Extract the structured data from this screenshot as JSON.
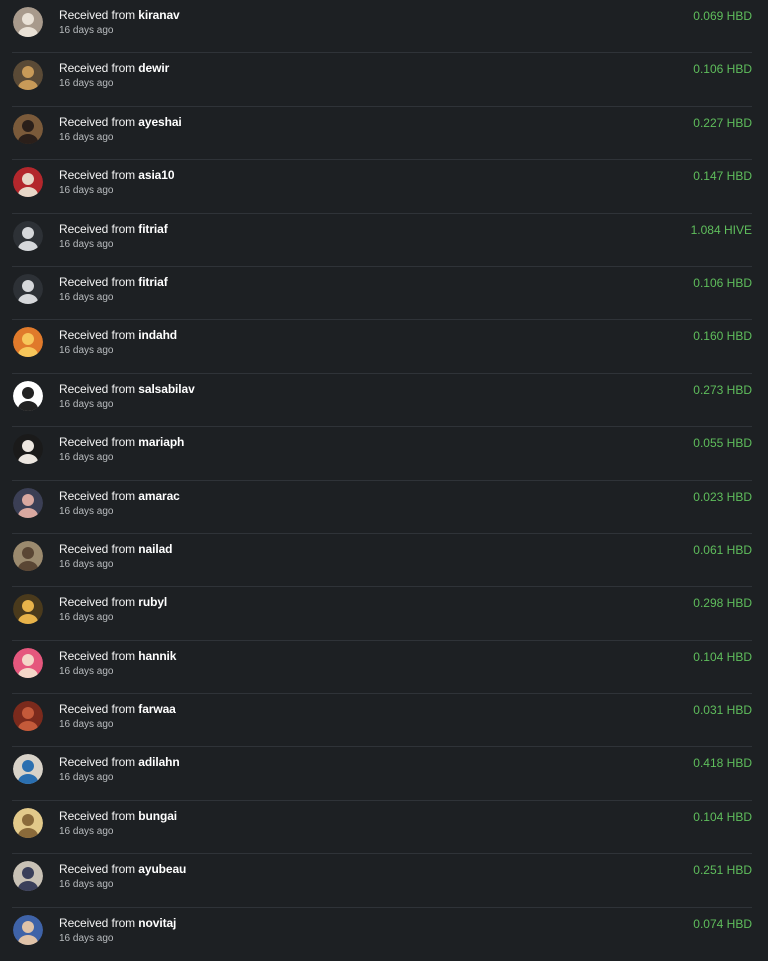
{
  "transactions": [
    {
      "prefix": "Received from",
      "user": "kiranav",
      "time": "16 days ago",
      "amount": "0.069 HBD",
      "avatar_color": "#a89a8c",
      "avatar_accent": "#e9e1d6",
      "avatar_icon": "user-avatar-icon"
    },
    {
      "prefix": "Received from",
      "user": "dewir",
      "time": "16 days ago",
      "amount": "0.106 HBD",
      "avatar_color": "#5a4a36",
      "avatar_accent": "#c89a58",
      "avatar_icon": "user-avatar-icon"
    },
    {
      "prefix": "Received from",
      "user": "ayeshai",
      "time": "16 days ago",
      "amount": "0.227 HBD",
      "avatar_color": "#7a5a3a",
      "avatar_accent": "#2a1f1a",
      "avatar_icon": "user-avatar-icon"
    },
    {
      "prefix": "Received from",
      "user": "asia10",
      "time": "16 days ago",
      "amount": "0.147 HBD",
      "avatar_color": "#b3272c",
      "avatar_accent": "#e8d7c8",
      "avatar_icon": "user-avatar-icon"
    },
    {
      "prefix": "Received from",
      "user": "fitriaf",
      "time": "16 days ago",
      "amount": "1.084 HIVE",
      "avatar_color": "#2d3136",
      "avatar_accent": "#d5d7da",
      "avatar_icon": "user-avatar-icon"
    },
    {
      "prefix": "Received from",
      "user": "fitriaf",
      "time": "16 days ago",
      "amount": "0.106 HBD",
      "avatar_color": "#2d3136",
      "avatar_accent": "#d5d7da",
      "avatar_icon": "user-avatar-icon"
    },
    {
      "prefix": "Received from",
      "user": "indahd",
      "time": "16 days ago",
      "amount": "0.160 HBD",
      "avatar_color": "#e07a2b",
      "avatar_accent": "#f7c65a",
      "avatar_icon": "user-avatar-icon"
    },
    {
      "prefix": "Received from",
      "user": "salsabilav",
      "time": "16 days ago",
      "amount": "0.273 HBD",
      "avatar_color": "#ffffff",
      "avatar_accent": "#222222",
      "avatar_icon": "user-avatar-icon"
    },
    {
      "prefix": "Received from",
      "user": "mariaph",
      "time": "16 days ago",
      "amount": "0.055 HBD",
      "avatar_color": "#1a1a1a",
      "avatar_accent": "#ece6e0",
      "avatar_icon": "user-avatar-icon"
    },
    {
      "prefix": "Received from",
      "user": "amarac",
      "time": "16 days ago",
      "amount": "0.023 HBD",
      "avatar_color": "#3b3f55",
      "avatar_accent": "#d9a8a0",
      "avatar_icon": "user-avatar-icon"
    },
    {
      "prefix": "Received from",
      "user": "nailad",
      "time": "16 days ago",
      "amount": "0.061 HBD",
      "avatar_color": "#9b8a6e",
      "avatar_accent": "#5a4634",
      "avatar_icon": "user-avatar-icon"
    },
    {
      "prefix": "Received from",
      "user": "rubyl",
      "time": "16 days ago",
      "amount": "0.298 HBD",
      "avatar_color": "#4a3a1c",
      "avatar_accent": "#e8b34a",
      "avatar_icon": "user-avatar-icon"
    },
    {
      "prefix": "Received from",
      "user": "hannik",
      "time": "16 days ago",
      "amount": "0.104 HBD",
      "avatar_color": "#e5577d",
      "avatar_accent": "#f4d6c8",
      "avatar_icon": "user-avatar-icon"
    },
    {
      "prefix": "Received from",
      "user": "farwaa",
      "time": "16 days ago",
      "amount": "0.031 HBD",
      "avatar_color": "#7b2a1c",
      "avatar_accent": "#c45a3a",
      "avatar_icon": "user-avatar-icon"
    },
    {
      "prefix": "Received from",
      "user": "adilahn",
      "time": "16 days ago",
      "amount": "0.418 HBD",
      "avatar_color": "#d8d2c8",
      "avatar_accent": "#2a6fb0",
      "avatar_icon": "user-avatar-icon"
    },
    {
      "prefix": "Received from",
      "user": "bungai",
      "time": "16 days ago",
      "amount": "0.104 HBD",
      "avatar_color": "#e2c98a",
      "avatar_accent": "#8a6a3a",
      "avatar_icon": "user-avatar-icon"
    },
    {
      "prefix": "Received from",
      "user": "ayubeau",
      "time": "16 days ago",
      "amount": "0.251 HBD",
      "avatar_color": "#c9c2b6",
      "avatar_accent": "#3a3f5a",
      "avatar_icon": "user-avatar-icon"
    },
    {
      "prefix": "Received from",
      "user": "novitaj",
      "time": "16 days ago",
      "amount": "0.074 HBD",
      "avatar_color": "#3f63a8",
      "avatar_accent": "#e0c3a8",
      "avatar_icon": "user-avatar-icon"
    }
  ]
}
